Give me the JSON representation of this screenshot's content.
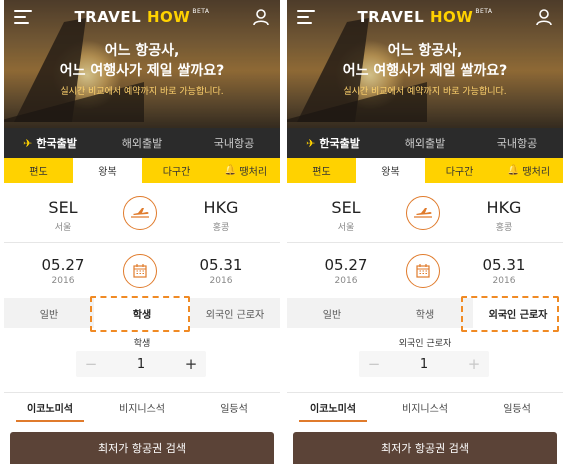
{
  "colors": {
    "accent": "#ffd200",
    "highlight": "#f08a24",
    "button": "#5b4337",
    "dark_bar": "#2b2b2b"
  },
  "panels": [
    {
      "logo": {
        "travel": "TRAVEL",
        "how": "HOW",
        "beta": "BETA"
      },
      "headline_1": "어느 항공사,",
      "headline_2": "어느 여행사가 제일 쌀까요?",
      "subtitle": "실시간 비교에서 예약까지 바로 가능합니다.",
      "region_tabs": [
        "한국출발",
        "해외출발",
        "국내항공"
      ],
      "trip_tabs": [
        "편도",
        "왕복",
        "다구간",
        "땡처리"
      ],
      "origin": {
        "code": "SEL",
        "city": "서울"
      },
      "destination": {
        "code": "HKG",
        "city": "홍콩"
      },
      "depart": {
        "date": "05.27",
        "year": "2016"
      },
      "return": {
        "date": "05.31",
        "year": "2016"
      },
      "passenger_types": [
        "일반",
        "학생",
        "외국인 근로자"
      ],
      "selected_passenger_type": "학생",
      "passenger_label": "학생",
      "passenger_count": "1",
      "stepper_minus": "−",
      "stepper_plus": "+",
      "cabins": [
        "이코노미석",
        "비지니스석",
        "일등석"
      ],
      "search_label": "최저가 항공권 검색"
    },
    {
      "logo": {
        "travel": "TRAVEL",
        "how": "HOW",
        "beta": "BETA"
      },
      "headline_1": "어느 항공사,",
      "headline_2": "어느 여행사가 제일 쌀까요?",
      "subtitle": "실시간 비교에서 예약까지 바로 가능합니다.",
      "region_tabs": [
        "한국출발",
        "해외출발",
        "국내항공"
      ],
      "trip_tabs": [
        "편도",
        "왕복",
        "다구간",
        "땡처리"
      ],
      "origin": {
        "code": "SEL",
        "city": "서울"
      },
      "destination": {
        "code": "HKG",
        "city": "홍콩"
      },
      "depart": {
        "date": "05.27",
        "year": "2016"
      },
      "return": {
        "date": "05.31",
        "year": "2016"
      },
      "passenger_types": [
        "일반",
        "학생",
        "외국인 근로자"
      ],
      "selected_passenger_type": "외국인 근로자",
      "passenger_label": "외국인 근로자",
      "passenger_count": "1",
      "stepper_minus": "−",
      "stepper_plus": "+",
      "cabins": [
        "이코노미석",
        "비지니스석",
        "일등석"
      ],
      "search_label": "최저가 항공권 검색"
    }
  ]
}
